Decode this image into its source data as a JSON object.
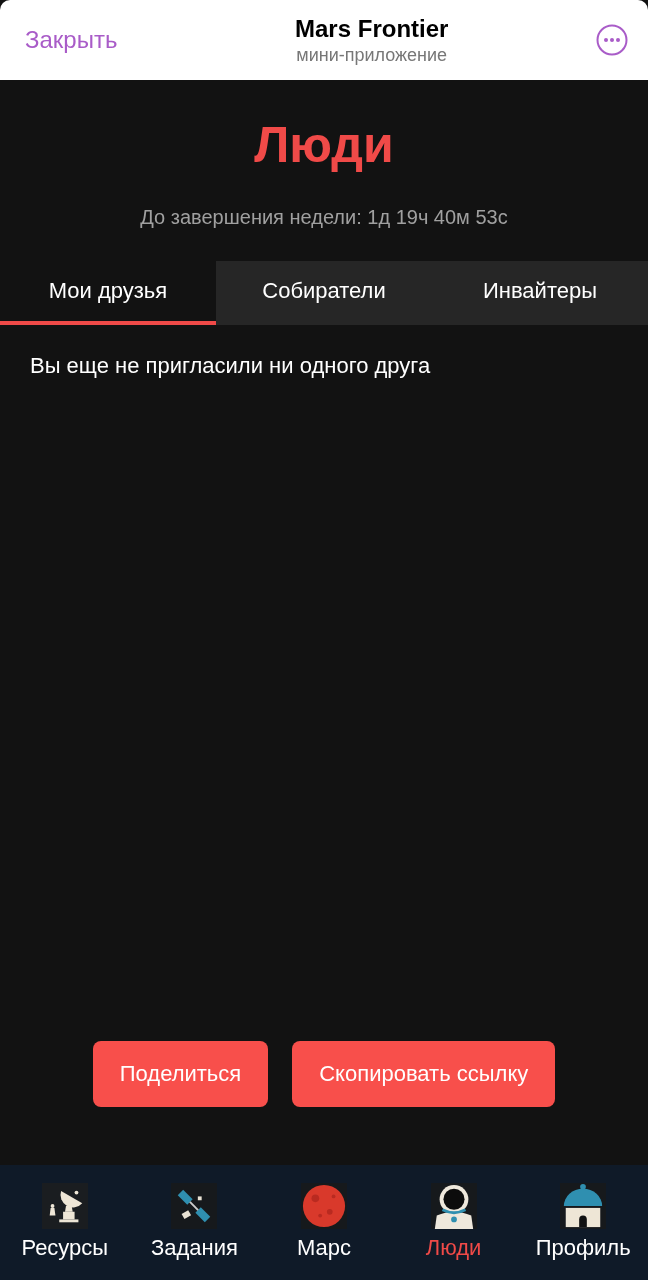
{
  "header": {
    "close": "Закрыть",
    "title": "Mars Frontier",
    "subtitle": "мини-приложение"
  },
  "page": {
    "title": "Люди",
    "timer": "До завершения недели: 1д 19ч 40м 53с"
  },
  "tabs": [
    {
      "label": "Мои друзья",
      "selected": true
    },
    {
      "label": "Собиратели",
      "selected": false
    },
    {
      "label": "Инвайтеры",
      "selected": false
    }
  ],
  "empty_message": "Вы еще не пригласили ни одного друга",
  "buttons": [
    "Поделиться",
    "Скопировать ссылку"
  ],
  "nav": [
    {
      "label": "Ресурсы",
      "kind": "dish",
      "selected": false
    },
    {
      "label": "Задания",
      "kind": "satellite",
      "selected": false
    },
    {
      "label": "Марс",
      "kind": "planet",
      "selected": false
    },
    {
      "label": "Люди",
      "kind": "astronaut",
      "selected": true
    },
    {
      "label": "Профиль",
      "kind": "observatory",
      "selected": false
    }
  ]
}
